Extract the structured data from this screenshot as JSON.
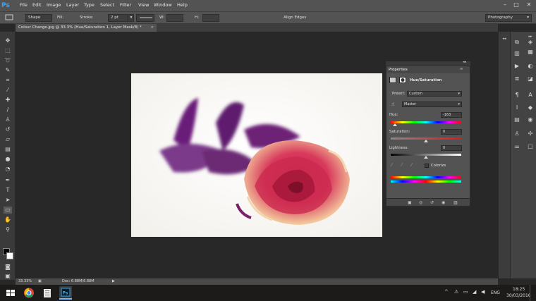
{
  "app": {
    "logo": "Ps"
  },
  "menu": [
    "File",
    "Edit",
    "Image",
    "Layer",
    "Type",
    "Select",
    "Filter",
    "View",
    "Window",
    "Help"
  ],
  "window_controls": {
    "minimize": "–",
    "maximize": "□",
    "close": "✕"
  },
  "options": {
    "mode": "Shape",
    "fill_label": "Fill:",
    "stroke_label": "Stroke:",
    "stroke_width": "2 pt",
    "w_label": "W:",
    "h_label": "H:",
    "align_edges": "Align Edges",
    "workspace": "Photography",
    "stroke_color": "#e01010"
  },
  "document": {
    "tab": "Colour Change.jpg @ 33.3% (Hue/Saturation 1, Layer Mask/8) *"
  },
  "properties": {
    "title": "Properties",
    "panel_type": "Hue/Saturation",
    "preset_label": "Preset:",
    "preset_value": "Custom",
    "channel_value": "Master",
    "hue_label": "Hue:",
    "hue_value": "-163",
    "saturation_label": "Saturation:",
    "saturation_value": "0",
    "lightness_label": "Lightness:",
    "lightness_value": "0",
    "colorize_label": "Colorize"
  },
  "status": {
    "zoom": "33.33%",
    "doc": "Doc: 6.88M/6.88M"
  },
  "taskbar": {
    "lang": "ENG",
    "time": "18:25",
    "date": "30/03/2016"
  }
}
